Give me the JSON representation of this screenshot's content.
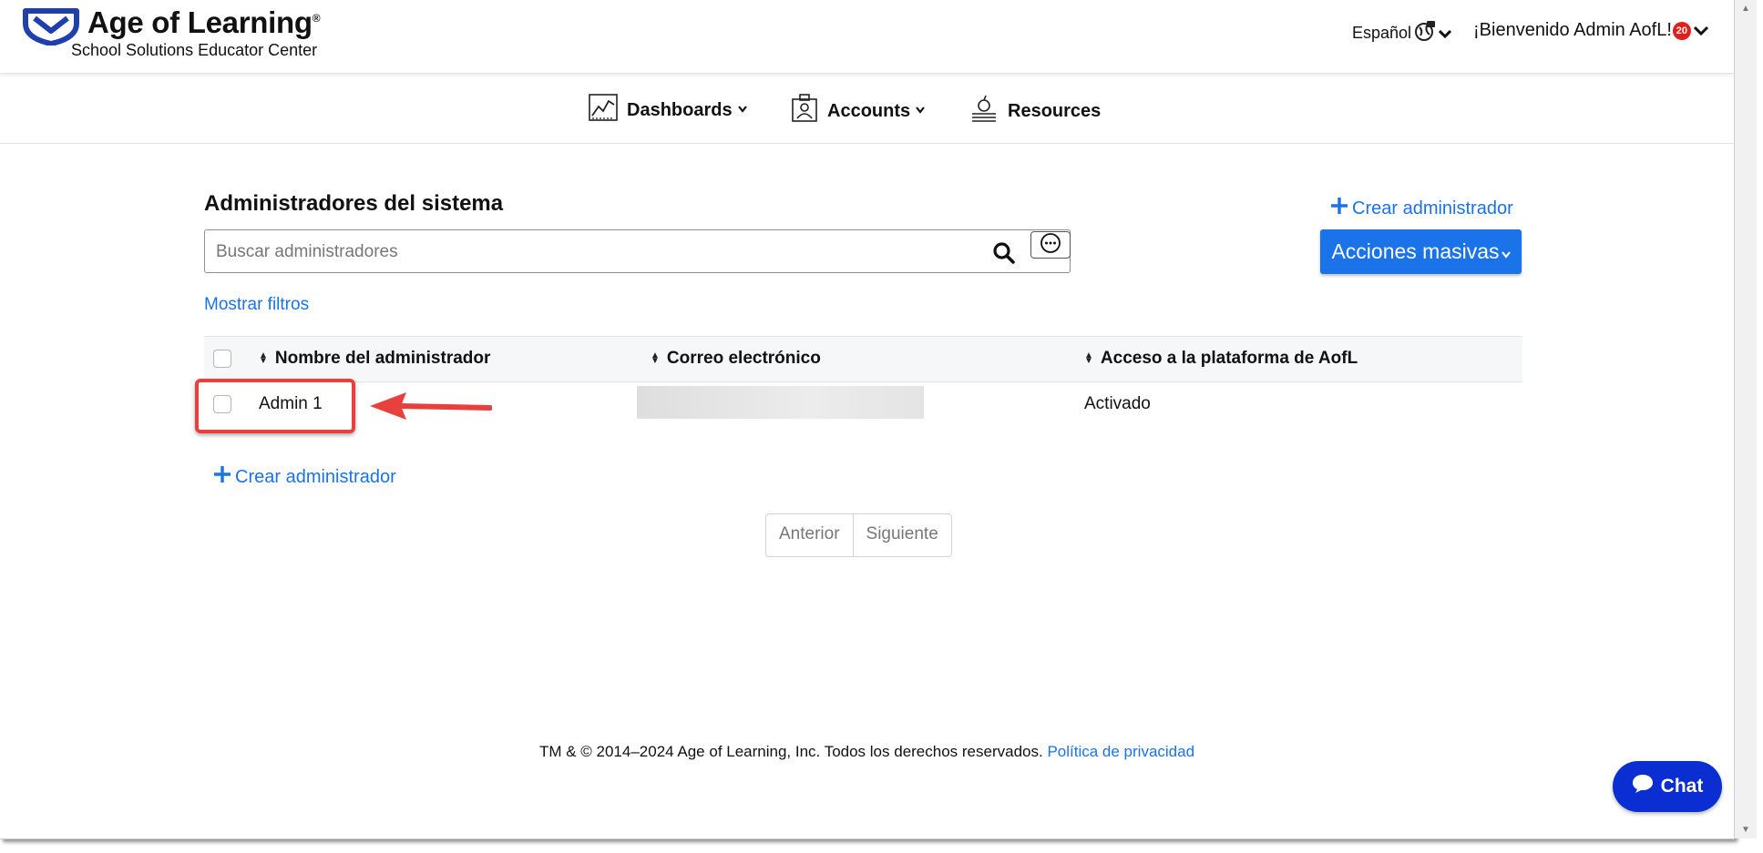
{
  "header": {
    "brand_name": "Age of Learning",
    "brand_mark": "®",
    "brand_subtitle": "School Solutions Educator Center",
    "language": "Español",
    "welcome": "¡Bienvenido Admin AofL!",
    "notification_count": "20"
  },
  "nav": {
    "items": [
      {
        "label": "Dashboards",
        "icon": "chart-icon"
      },
      {
        "label": "Accounts",
        "icon": "accounts-icon"
      },
      {
        "label": "Resources",
        "icon": "resources-icon"
      }
    ]
  },
  "main": {
    "title": "Administradores del sistema",
    "search_placeholder": "Buscar administradores",
    "show_filters": "Mostrar filtros",
    "create_admin": "Crear administrador",
    "bulk_actions": "Acciones masivas"
  },
  "table": {
    "columns": [
      "Nombre del administrador",
      "Correo electrónico",
      "Acceso a la plataforma de AofL"
    ],
    "rows": [
      {
        "name": "Admin 1",
        "email": "",
        "access": "Activado"
      }
    ]
  },
  "pagination": {
    "prev": "Anterior",
    "next": "Siguiente"
  },
  "footer": {
    "copyright": "TM & © 2014–2024 Age of Learning, Inc. Todos los derechos reservados.",
    "privacy": "Política de privacidad"
  },
  "chat": {
    "label": "Chat"
  },
  "colors": {
    "accent": "#1a73e8",
    "brand": "#1f3fae",
    "annotation": "#e8403c",
    "chat": "#0a2ed1"
  }
}
